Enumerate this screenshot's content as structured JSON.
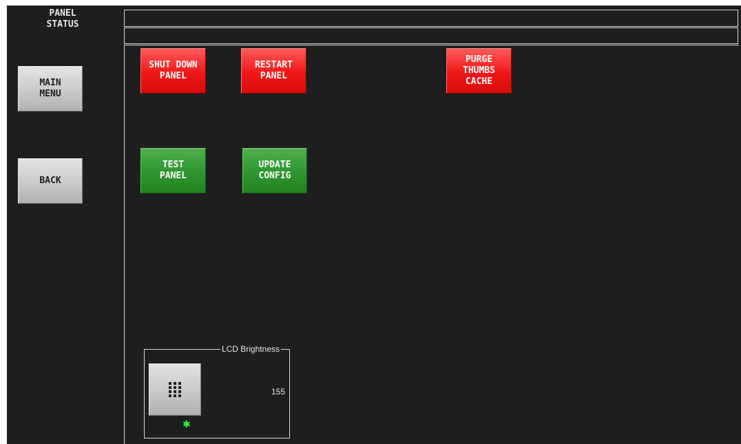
{
  "header": {
    "title": "PANEL\nSTATUS",
    "status_line_1": "",
    "status_line_2": ""
  },
  "nav": {
    "main_menu_label": "MAIN\nMENU",
    "back_label": "BACK"
  },
  "actions": {
    "shut_down_panel_label": "SHUT DOWN\nPANEL",
    "restart_panel_label": "RESTART\nPANEL",
    "purge_thumbs_cache_label": "PURGE\nTHUMBS\nCACHE",
    "test_panel_label": "TEST\nPANEL",
    "update_config_label": "UPDATE\nCONFIG"
  },
  "lcd_brightness": {
    "title": "LCD Brightness",
    "value": "155",
    "keypad_icon": "keypad-icon",
    "indicator_icon": "green-star-led-icon"
  },
  "colors": {
    "background": "#1e1e1e",
    "danger_button": "#f01616",
    "ok_button": "#2f9530",
    "nav_button": "#cfcfcf",
    "indicator": "#2cff2c"
  }
}
